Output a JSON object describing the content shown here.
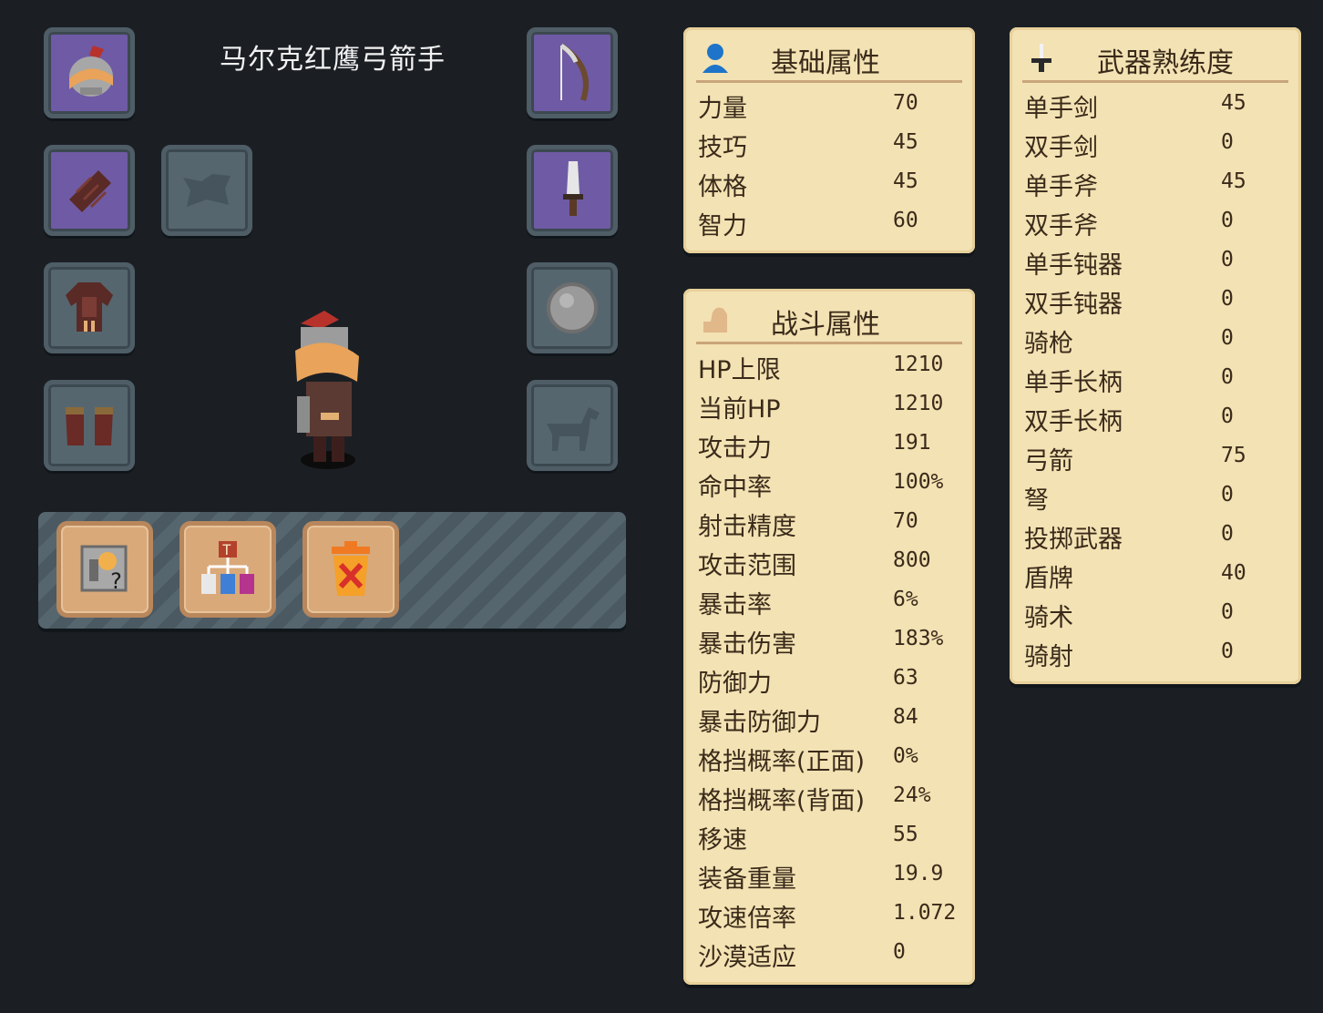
{
  "unit": {
    "name": "马尔克红鹰弓箭手"
  },
  "equipment": {
    "head": {
      "item": "helmet",
      "filled": true
    },
    "hands": {
      "item": "gloves",
      "filled": true
    },
    "back": {
      "item": "cape",
      "filled": false
    },
    "body": {
      "item": "armor",
      "filled": true
    },
    "feet": {
      "item": "boots",
      "filled": true
    },
    "main_weapon": {
      "item": "bow",
      "filled": true
    },
    "side_weapon": {
      "item": "dagger",
      "filled": true
    },
    "offhand": {
      "item": "round-shield",
      "filled": true
    },
    "mount": {
      "item": "horse",
      "filled": false
    }
  },
  "actions": [
    {
      "icon": "unit-info-icon"
    },
    {
      "icon": "upgrade-tree-icon"
    },
    {
      "icon": "dismiss-trash-icon"
    }
  ],
  "basic_stats": {
    "title": "基础属性",
    "icon": "person-icon",
    "rows": [
      {
        "label": "力量",
        "value": "70"
      },
      {
        "label": "技巧",
        "value": "45"
      },
      {
        "label": "体格",
        "value": "45"
      },
      {
        "label": "智力",
        "value": "60"
      }
    ]
  },
  "combat_stats": {
    "title": "战斗属性",
    "icon": "flexed-arm-icon",
    "rows": [
      {
        "label": "HP上限",
        "value": "1210"
      },
      {
        "label": "当前HP",
        "value": "1210"
      },
      {
        "label": "攻击力",
        "value": "191"
      },
      {
        "label": "命中率",
        "value": "100%"
      },
      {
        "label": "射击精度",
        "value": "70"
      },
      {
        "label": "攻击范围",
        "value": "800"
      },
      {
        "label": "暴击率",
        "value": "6%"
      },
      {
        "label": "暴击伤害",
        "value": "183%"
      },
      {
        "label": "防御力",
        "value": "63"
      },
      {
        "label": "暴击防御力",
        "value": "84"
      },
      {
        "label": "格挡概率(正面)",
        "value": "0%"
      },
      {
        "label": "格挡概率(背面)",
        "value": "24%"
      },
      {
        "label": "移速",
        "value": "55"
      },
      {
        "label": "装备重量",
        "value": "19.9"
      },
      {
        "label": "攻速倍率",
        "value": "1.072"
      },
      {
        "label": "沙漠适应",
        "value": "0"
      }
    ]
  },
  "weapon_proficiency": {
    "title": "武器熟练度",
    "icon": "sword-icon",
    "rows": [
      {
        "label": "单手剑",
        "value": "45"
      },
      {
        "label": "双手剑",
        "value": "0"
      },
      {
        "label": "单手斧",
        "value": "45"
      },
      {
        "label": "双手斧",
        "value": "0"
      },
      {
        "label": "单手钝器",
        "value": "0"
      },
      {
        "label": "双手钝器",
        "value": "0"
      },
      {
        "label": "骑枪",
        "value": "0"
      },
      {
        "label": "单手长柄",
        "value": "0"
      },
      {
        "label": "双手长柄",
        "value": "0"
      },
      {
        "label": "弓箭",
        "value": "75"
      },
      {
        "label": "弩",
        "value": "0"
      },
      {
        "label": "投掷武器",
        "value": "0"
      },
      {
        "label": "盾牌",
        "value": "40"
      },
      {
        "label": "骑术",
        "value": "0"
      },
      {
        "label": "骑射",
        "value": "0"
      }
    ]
  }
}
